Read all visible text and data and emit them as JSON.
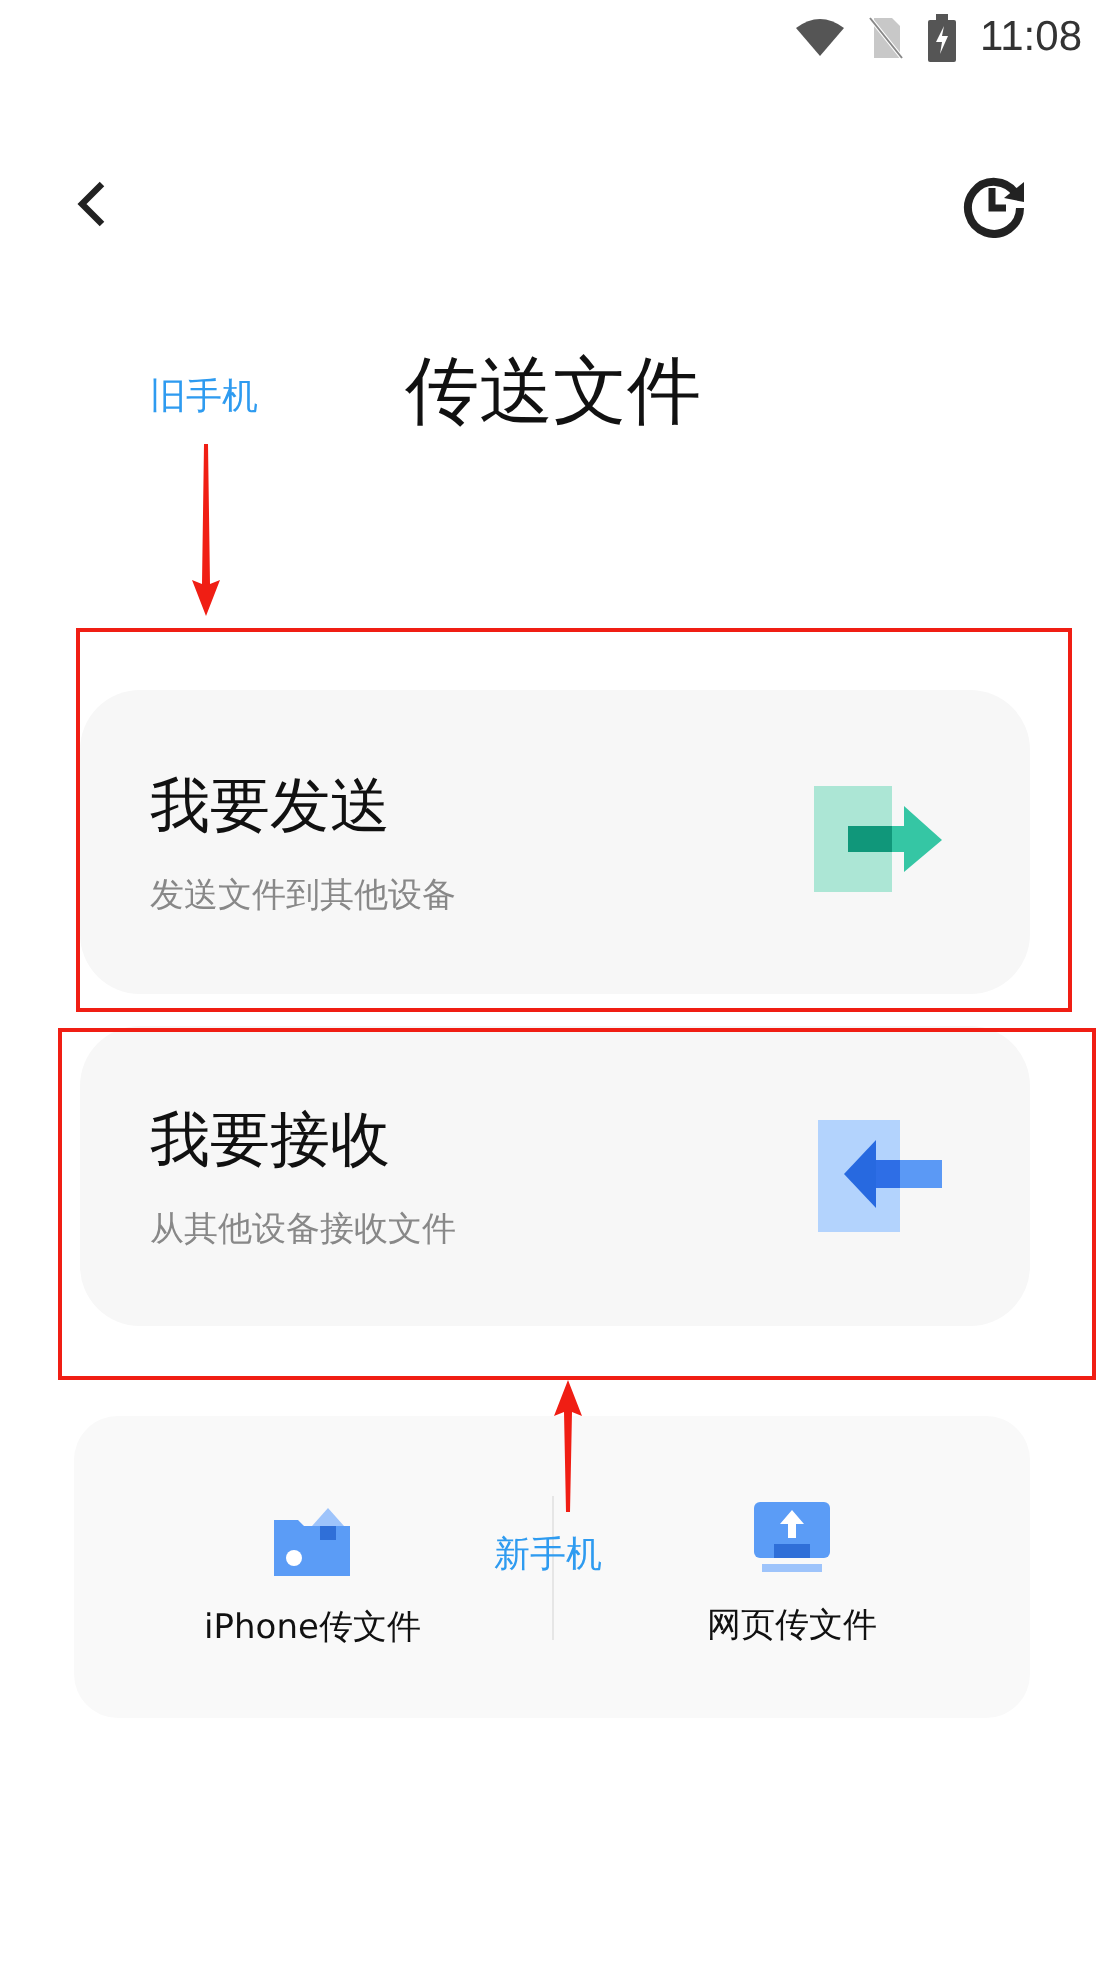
{
  "status_bar": {
    "time": "11:08"
  },
  "header": {
    "title": "传送文件"
  },
  "options": [
    {
      "kind": "send",
      "title": "我要发送",
      "subtitle": "发送文件到其他设备"
    },
    {
      "kind": "receive",
      "title": "我要接收",
      "subtitle": "从其他设备接收文件"
    }
  ],
  "other_transfers": [
    {
      "kind": "iphone",
      "label": "iPhone传文件"
    },
    {
      "kind": "web",
      "label": "网页传文件"
    }
  ],
  "annotations": {
    "old_phone_label": "旧手机",
    "new_phone_label": "新手机"
  }
}
